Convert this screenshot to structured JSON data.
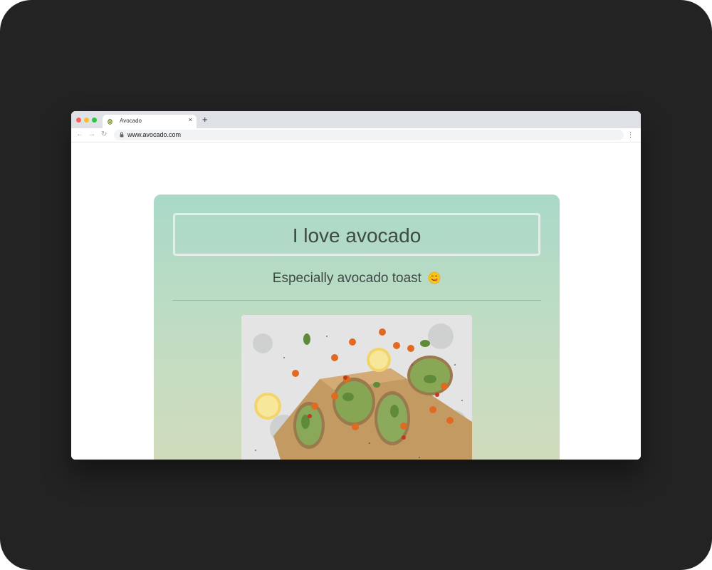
{
  "browser": {
    "tab_title": "Avocado",
    "tab_close": "×",
    "new_tab": "+",
    "url": "www.avocado.com",
    "nav": {
      "back": "←",
      "forward": "→",
      "reload": "↻",
      "menu": "⋮"
    }
  },
  "page": {
    "title": "I love avocado",
    "subtitle": "Especially avocado toast"
  },
  "icons": {
    "favicon": "avocado-icon",
    "lock": "lock-icon",
    "emoji": "yum-face-emoji"
  },
  "colors": {
    "frame": "#232323",
    "card_top": "#a9d9c8",
    "card_bottom": "#d3dbbb",
    "text": "#3e4a44"
  }
}
